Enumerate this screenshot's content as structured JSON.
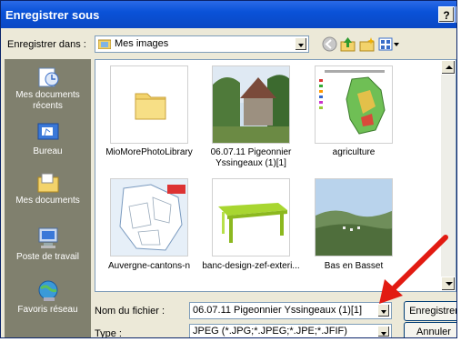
{
  "window": {
    "title": "Enregistrer sous",
    "help_label": "?",
    "close_label": "x"
  },
  "toolbar": {
    "save_in_label": "Enregistrer dans :",
    "location_value": "Mes images",
    "icons": [
      "back-icon",
      "up-folder-icon",
      "new-folder-icon",
      "view-menu-icon"
    ]
  },
  "places": [
    {
      "label": "Mes documents récents",
      "icon": "recent-documents-icon"
    },
    {
      "label": "Bureau",
      "icon": "desktop-icon"
    },
    {
      "label": "Mes documents",
      "icon": "my-documents-icon"
    },
    {
      "label": "Poste de travail",
      "icon": "my-computer-icon"
    },
    {
      "label": "Favoris réseau",
      "icon": "network-places-icon"
    }
  ],
  "files": [
    {
      "name": "MioMorePhotoLibrary",
      "kind": "folder"
    },
    {
      "name": "06.07.11 Pigeonnier Yssingeaux (1)[1]",
      "kind": "photo"
    },
    {
      "name": "agriculture",
      "kind": "map"
    },
    {
      "name": "Auvergne-cantons-n",
      "kind": "map"
    },
    {
      "name": "banc-design-zef-exteri...",
      "kind": "photo"
    },
    {
      "name": "Bas en Basset",
      "kind": "photo"
    }
  ],
  "footer": {
    "filename_label": "Nom du fichier :",
    "filename_value": "06.07.11 Pigeonnier Yssingeaux (1)[1]",
    "type_label": "Type :",
    "type_value": "JPEG (*.JPG;*.JPEG;*.JPE;*.JFIF)",
    "save_button": "Enregistrer",
    "cancel_button": "Annuler"
  },
  "colors": {
    "title_bar": "#0a52d8",
    "places_bg": "#80806e",
    "arrow": "#e21b12"
  }
}
